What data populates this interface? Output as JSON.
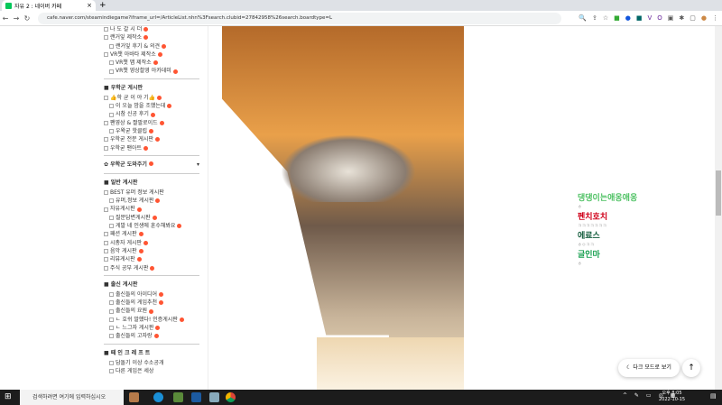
{
  "browser": {
    "tab_title": "자유 2 : 네이버 카페",
    "url": "cafe.naver.com/steamindiegame?iframe_url=/ArticleList.nhn%3Fsearch.clubid=27842958%26search.boardtype=L"
  },
  "sidebar": {
    "group0": [
      "나 도 갈 시 더",
      "랜거잎 제작소",
      "랜거잎 후기 & 의견",
      "VR챗 아바타 제작소",
      "VR챗 맵 제작소",
      "VR챗 영상촬영 아카데미"
    ],
    "group1_title": "우학군 게시판",
    "group1": [
      "👍학 균 이 야 기👍",
      "이 오늘 밤을 조했는데",
      "시참 신공 후기",
      "팬영상 & 짤팔로이드",
      "우왁굳 핫클립",
      "우학굳 전문 게시판",
      "우학굳 팬아트"
    ],
    "help_title": "우학군 도와주기",
    "group2_title": "일반 게시판",
    "group2": [
      "BEST 유머 정보 게시판",
      "유머,정보 게시판",
      "자유게시판",
      "질문답변게시판",
      "게발 네 인생에 훈수해봐요",
      "패션 게시판",
      "시총자 게시판",
      "음악 게시판",
      "리뷰게시판",
      "주식 공부 게시판"
    ],
    "group3_title": "출신 게시판",
    "group3": [
      "출신들의 아이디어",
      "출신들의 게임추천",
      "출신들의 요원",
      "ㄴ 호쉬 발했다! 인증게시판",
      "ㄴ 느그자 게시판",
      "출신들의 고자랑"
    ],
    "group4_title": "떼 인 크 레 프 트",
    "group4": [
      "담돌기 이상 수소공개",
      "다른 게임은 세상"
    ]
  },
  "right_panel": [
    {
      "name": "댕댕이는애옹애옹",
      "sub": "ㅎ",
      "color": "#4fc264"
    },
    {
      "name": "펜치호치",
      "sub": "ㅋㅋㅋㅋㅋㅋㅋ",
      "color": "#d0021b"
    },
    {
      "name": "에료스",
      "sub": "ㅎㅇㅋㅋ",
      "color": "#135c3c"
    },
    {
      "name": "글인마",
      "sub": "ㅎ",
      "color": "#18a050"
    }
  ],
  "buttons": {
    "dark_mode": "다크 모드로 보기",
    "top": "↑"
  },
  "taskbar": {
    "search_placeholder": "검색하려면 여기에 입력하십시오",
    "time": "오후 8:05",
    "date": "2022-10-15"
  }
}
